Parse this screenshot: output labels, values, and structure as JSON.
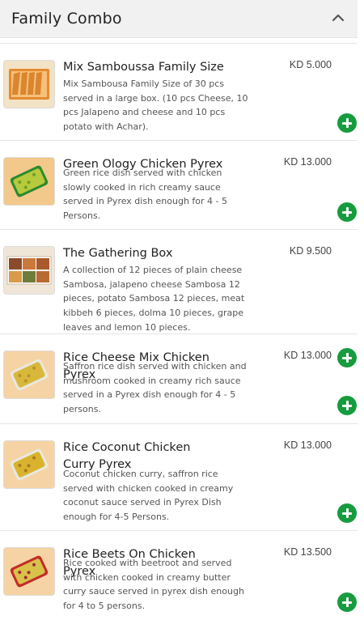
{
  "section": {
    "title": "Family Combo",
    "toggle_icon": "chevron-up-icon"
  },
  "colors": {
    "add_button": "#169c3e",
    "header_bg": "#f1f1f1"
  },
  "items": [
    {
      "name": "Mix Samboussa Family Size",
      "price": "KD 5.000",
      "description": "Mix Sambousa Family Size of 30 pcs served in a large box. (10 pcs Cheese, 10 pcs Jalapeno and cheese and 10 pcs potato with Achar).",
      "image": "samboussa-box-image"
    },
    {
      "name": "Green Ology Chicken Pyrex",
      "price": "KD 13.000",
      "description": "Green rice dish served with chicken slowly cooked in rich creamy sauce served in Pyrex dish enough for 4 - 5 Persons.",
      "image": "green-rice-pyrex-image"
    },
    {
      "name": "The Gathering Box",
      "price": "KD 9.500",
      "description": "A collection of 12 pieces of plain cheese Sambosa, jalapeno cheese Sambosa 12 pieces, potato Sambosa 12 pieces, meat kibbeh 6 pieces, dolma 10 pieces, grape leaves and lemon 10 pieces.",
      "image": "gathering-box-image"
    },
    {
      "name": "Rice Cheese Mix Chicken Pyrex",
      "price": "KD 13.000",
      "description": "Saffron rice dish served with chicken and mushroom cooked in creamy rich sauce served in a Pyrex dish enough for 4 - 5 persons.",
      "image": "saffron-rice-pyrex-image"
    },
    {
      "name": "Rice Coconut Chicken Curry Pyrex",
      "price": "KD 13.000",
      "description": "Coconut chicken curry, saffron rice served with chicken cooked in creamy coconut sauce served in Pyrex Dish enough for 4-5 Persons.",
      "image": "coconut-curry-pyrex-image"
    },
    {
      "name": "Rice Beets On Chicken Pyrex",
      "price": "KD 13.500",
      "description": "Rice cooked with beetroot and served with chicken cooked in creamy butter curry sauce served in pyrex dish enough for 4 to 5 persons.",
      "image": "beet-rice-pyrex-image"
    }
  ]
}
